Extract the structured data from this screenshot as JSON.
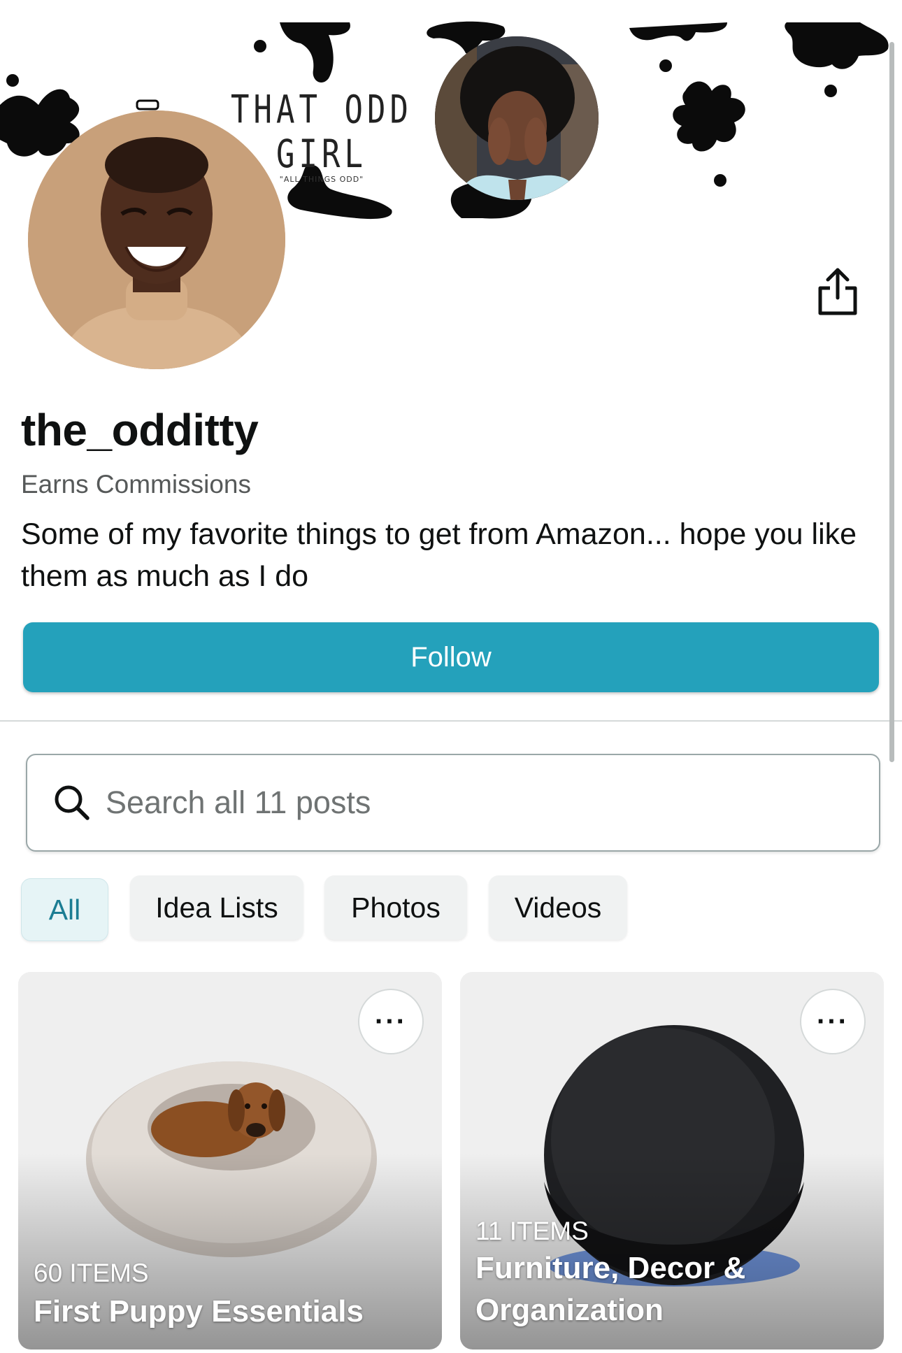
{
  "banner": {
    "brand_title": "THAT ODD GIRL",
    "brand_tagline": "\"ALL THINGS ODD\""
  },
  "profile": {
    "username": "the_odditty",
    "badge": "Earns Commissions",
    "bio": "Some of my favorite things to get from Amazon... hope you like them as much as I do",
    "follow_label": "Follow"
  },
  "search": {
    "placeholder": "Search all 11 posts"
  },
  "filters": [
    {
      "label": "All",
      "active": true
    },
    {
      "label": "Idea Lists",
      "active": false
    },
    {
      "label": "Photos",
      "active": false
    },
    {
      "label": "Videos",
      "active": false
    }
  ],
  "cards": [
    {
      "count": "60 ITEMS",
      "title": "First Puppy Essentials",
      "image": "dog-bed-with-dachshund"
    },
    {
      "count": "11 ITEMS",
      "title": "Furniture, Decor & Organization",
      "image": "smart-speaker-sphere"
    }
  ],
  "icons": {
    "share": "share-icon",
    "search": "search-icon",
    "more": "more-options-icon"
  },
  "colors": {
    "follow_button": "#24a1bb",
    "active_chip_bg": "#e6f4f6",
    "active_chip_text": "#1b7d93"
  }
}
